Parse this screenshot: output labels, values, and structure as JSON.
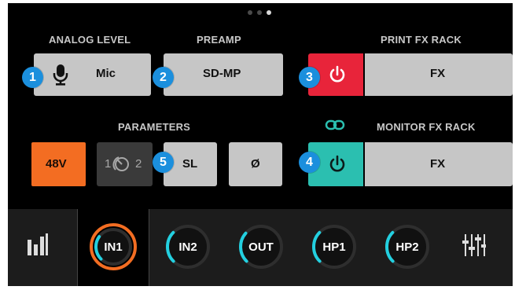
{
  "sections": {
    "analog_level": "ANALOG LEVEL",
    "preamp": "PREAMP",
    "print_fx_rack": "PRINT FX RACK",
    "parameters": "PARAMETERS",
    "monitor_fx_rack": "MONITOR FX RACK"
  },
  "buttons": {
    "mic": "Mic",
    "preamp_model": "SD-MP",
    "print_fx": "FX",
    "phantom_48v": "48V",
    "gain_range_left": "1",
    "gain_range_right": "2",
    "sl": "SL",
    "phase": "Ø",
    "monitor_fx": "FX"
  },
  "badges": [
    "1",
    "2",
    "3",
    "4",
    "5"
  ],
  "knobs": [
    {
      "label": "IN1",
      "level": 0.3
    },
    {
      "label": "IN2",
      "level": 0.33
    },
    {
      "label": "OUT",
      "level": 0.32
    },
    {
      "label": "HP1",
      "level": 0.33
    },
    {
      "label": "HP2",
      "level": 0.33
    }
  ],
  "page_indicator": {
    "total": 3,
    "current": 3
  },
  "colors": {
    "badge": "#1b8fdd",
    "print_power_active": "#e8243a",
    "monitor_power_active": "#2bbfb0",
    "phantom_48v": "#f36d22",
    "knob_arc": "#23d0e0",
    "knob_selected_ring": "#f36d22"
  },
  "icons": {
    "mic": "microphone-icon",
    "power": "power-icon",
    "link": "link-icon",
    "gain_range": "knob-icon",
    "meters": "meters-icon",
    "mixer": "mixer-faders-icon"
  }
}
